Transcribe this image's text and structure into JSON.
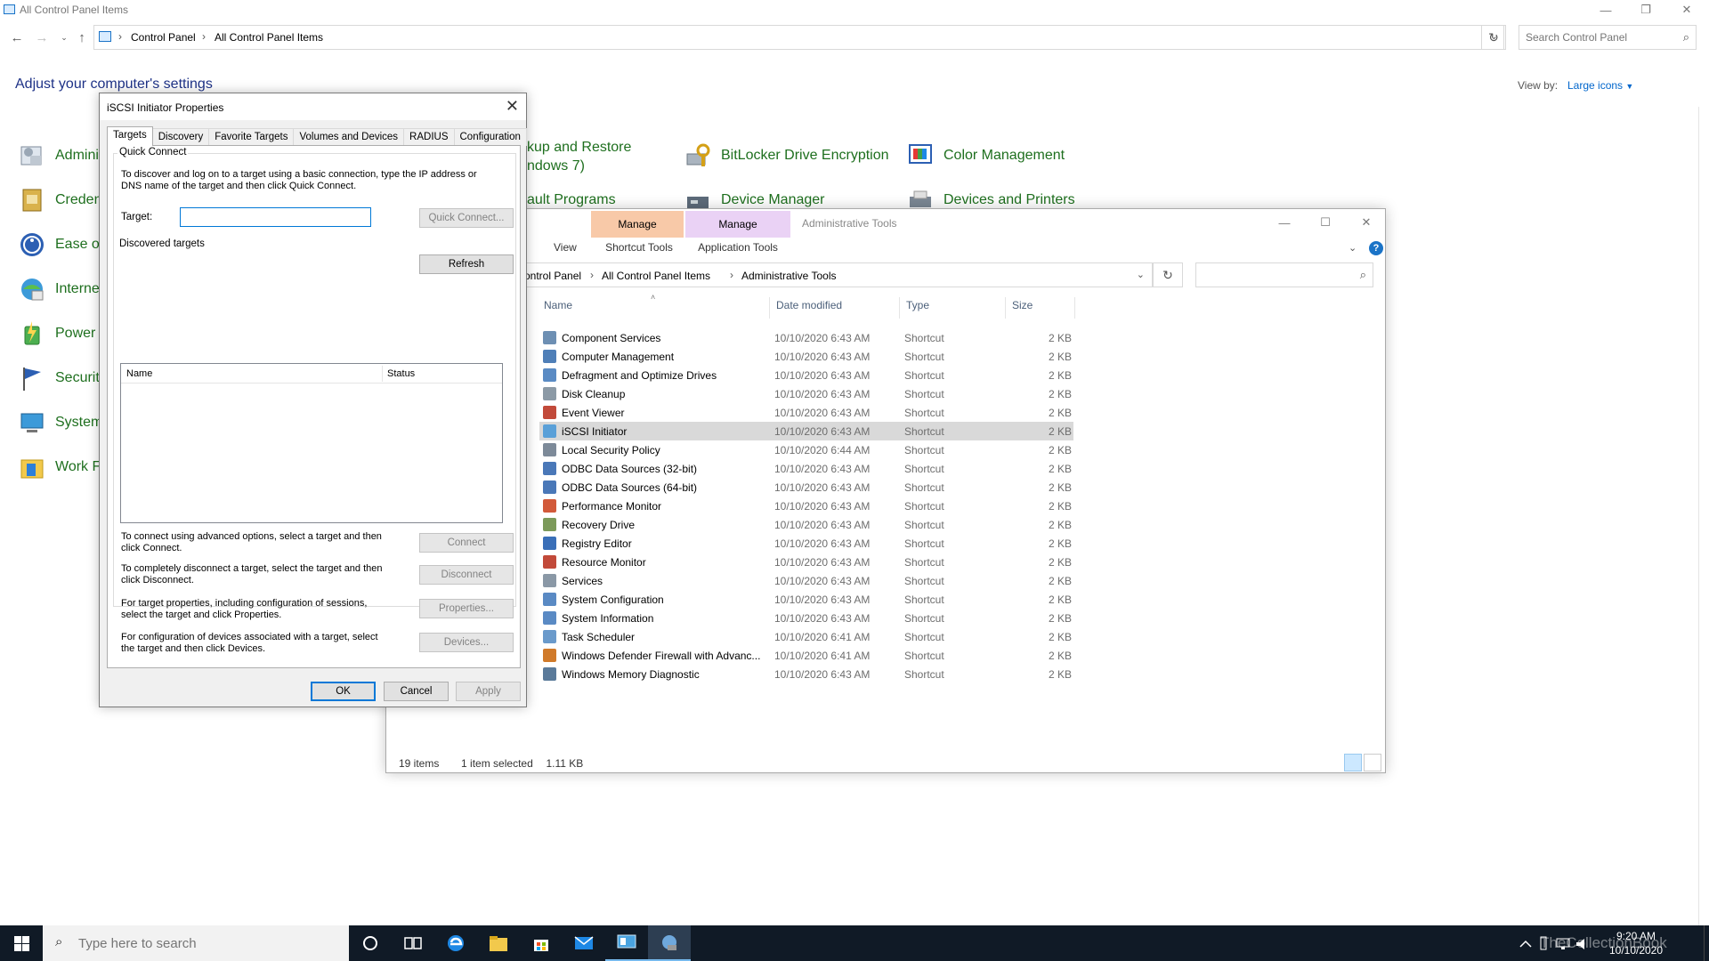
{
  "control_panel": {
    "window_title": "All Control Panel Items",
    "breadcrumb": [
      "Control Panel",
      "All Control Panel Items"
    ],
    "search_placeholder": "Search Control Panel",
    "heading": "Adjust your computer's settings",
    "view_by_label": "View by:",
    "view_by_value": "Large icons",
    "items_left": [
      "Admini",
      "Creden",
      "Ease of",
      "Interne",
      "Power (",
      "Securit",
      "System",
      "Work F"
    ],
    "items_mid": [
      "kup and Restore",
      "ndows 7)",
      "ault Programs"
    ],
    "items_right1": [
      "BitLocker Drive Encryption",
      "Device Manager"
    ],
    "items_right2": [
      "Color Management",
      "Devices and Printers"
    ]
  },
  "iscsi_dialog": {
    "title": "iSCSI Initiator Properties",
    "tabs": [
      "Targets",
      "Discovery",
      "Favorite Targets",
      "Volumes and Devices",
      "RADIUS",
      "Configuration"
    ],
    "quick_connect_label": "Quick Connect",
    "quick_connect_text": "To discover and log on to a target using a basic connection, type the IP address or DNS name of the target and then click Quick Connect.",
    "target_label": "Target:",
    "target_value": "",
    "quick_connect_button": "Quick Connect...",
    "discovered_label": "Discovered targets",
    "refresh_button": "Refresh",
    "list_columns": [
      "Name",
      "Status"
    ],
    "connect_text": "To connect using advanced options, select a target and then click Connect.",
    "connect_button": "Connect",
    "disconnect_text": "To completely disconnect a target, select the target and then click Disconnect.",
    "disconnect_button": "Disconnect",
    "properties_text": "For target properties, including configuration of sessions, select the target and click Properties.",
    "properties_button": "Properties...",
    "devices_text": "For configuration of devices associated with a target, select the target and then click Devices.",
    "devices_button": "Devices...",
    "ok_button": "OK",
    "cancel_button": "Cancel",
    "apply_button": "Apply"
  },
  "admin_tools": {
    "title": "Administrative Tools",
    "ribbon": {
      "manage1": "Manage",
      "manage2": "Manage",
      "view_tab": "View",
      "shortcut_tools": "Shortcut Tools",
      "application_tools": "Application Tools"
    },
    "manage1_color": "#f8c9a8",
    "manage2_color": "#ead2f5",
    "breadcrumb": [
      "ontrol Panel",
      "All Control Panel Items",
      "Administrative Tools"
    ],
    "columns": [
      "Name",
      "Date modified",
      "Type",
      "Size"
    ],
    "files": [
      {
        "name": "Component Services",
        "date": "10/10/2020 6:43 AM",
        "type": "Shortcut",
        "size": "2 KB",
        "icon": "component-services-icon"
      },
      {
        "name": "Computer Management",
        "date": "10/10/2020 6:43 AM",
        "type": "Shortcut",
        "size": "2 KB",
        "icon": "computer-management-icon"
      },
      {
        "name": "Defragment and Optimize Drives",
        "date": "10/10/2020 6:43 AM",
        "type": "Shortcut",
        "size": "2 KB",
        "icon": "defrag-icon"
      },
      {
        "name": "Disk Cleanup",
        "date": "10/10/2020 6:43 AM",
        "type": "Shortcut",
        "size": "2 KB",
        "icon": "disk-cleanup-icon"
      },
      {
        "name": "Event Viewer",
        "date": "10/10/2020 6:43 AM",
        "type": "Shortcut",
        "size": "2 KB",
        "icon": "event-viewer-icon"
      },
      {
        "name": "iSCSI Initiator",
        "date": "10/10/2020 6:43 AM",
        "type": "Shortcut",
        "size": "2 KB",
        "icon": "iscsi-icon"
      },
      {
        "name": "Local Security Policy",
        "date": "10/10/2020 6:44 AM",
        "type": "Shortcut",
        "size": "2 KB",
        "icon": "security-policy-icon"
      },
      {
        "name": "ODBC Data Sources (32-bit)",
        "date": "10/10/2020 6:43 AM",
        "type": "Shortcut",
        "size": "2 KB",
        "icon": "odbc-icon"
      },
      {
        "name": "ODBC Data Sources (64-bit)",
        "date": "10/10/2020 6:43 AM",
        "type": "Shortcut",
        "size": "2 KB",
        "icon": "odbc-icon"
      },
      {
        "name": "Performance Monitor",
        "date": "10/10/2020 6:43 AM",
        "type": "Shortcut",
        "size": "2 KB",
        "icon": "performance-monitor-icon"
      },
      {
        "name": "Recovery Drive",
        "date": "10/10/2020 6:43 AM",
        "type": "Shortcut",
        "size": "2 KB",
        "icon": "recovery-drive-icon"
      },
      {
        "name": "Registry Editor",
        "date": "10/10/2020 6:43 AM",
        "type": "Shortcut",
        "size": "2 KB",
        "icon": "registry-editor-icon"
      },
      {
        "name": "Resource Monitor",
        "date": "10/10/2020 6:43 AM",
        "type": "Shortcut",
        "size": "2 KB",
        "icon": "resource-monitor-icon"
      },
      {
        "name": "Services",
        "date": "10/10/2020 6:43 AM",
        "type": "Shortcut",
        "size": "2 KB",
        "icon": "services-icon"
      },
      {
        "name": "System Configuration",
        "date": "10/10/2020 6:43 AM",
        "type": "Shortcut",
        "size": "2 KB",
        "icon": "system-config-icon"
      },
      {
        "name": "System Information",
        "date": "10/10/2020 6:43 AM",
        "type": "Shortcut",
        "size": "2 KB",
        "icon": "system-info-icon"
      },
      {
        "name": "Task Scheduler",
        "date": "10/10/2020 6:41 AM",
        "type": "Shortcut",
        "size": "2 KB",
        "icon": "task-scheduler-icon"
      },
      {
        "name": "Windows Defender Firewall with Advanc...",
        "date": "10/10/2020 6:41 AM",
        "type": "Shortcut",
        "size": "2 KB",
        "icon": "firewall-icon"
      },
      {
        "name": "Windows Memory Diagnostic",
        "date": "10/10/2020 6:43 AM",
        "type": "Shortcut",
        "size": "2 KB",
        "icon": "memory-diagnostic-icon"
      }
    ],
    "selected_index": 5,
    "status_items": "19 items",
    "status_selected": "1 item selected",
    "status_size": "1.11 KB"
  },
  "taskbar": {
    "search_placeholder": "Type here to search",
    "time": "9:20 AM",
    "date": "10/10/2020",
    "watermark": "TheCollectionBook"
  }
}
